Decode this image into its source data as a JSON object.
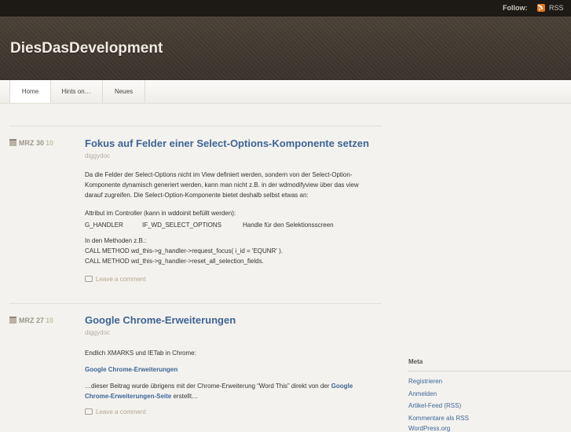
{
  "topbar": {
    "follow": "Follow:",
    "rss": "RSS"
  },
  "site": {
    "title": "DiesDasDevelopment"
  },
  "nav": {
    "items": [
      "Home",
      "Hints on…",
      "Neues"
    ]
  },
  "posts": [
    {
      "date": "MRZ 30",
      "year": "10",
      "title": "Fokus auf Felder einer Select-Options-Komponente setzen",
      "author": "diggydoc",
      "p1": [
        "Da die Felder der Select-Options nicht im View definiert werden, sondern von der Select-Option-",
        "Komponente dynamisch generiert werden, kann man nicht z.B. in der wdmodifyview über das view",
        "darauf zugreifen. Die Select-Option-Komponente bietet deshalb selbst etwas an:"
      ],
      "p2_line1": "Attribut im Controller (kann in wddoinit befüllt werden):",
      "p2_col1": "G_HANDLER",
      "p2_col2": "IF_WD_SELECT_OPTIONS",
      "p2_col3": "Handle für den Selektionsscreen",
      "p3": [
        "In den Methoden z.B.:",
        "CALL METHOD wd_this->g_handler->request_focus( i_id = 'EQUNR' ).",
        "CALL METHOD wd_this->g_handler->reset_all_selection_fields."
      ],
      "comment": "Leave a comment"
    },
    {
      "date": "MRZ 27",
      "year": "10",
      "title": "Google Chrome-Erweiterungen",
      "author": "diggydoc",
      "p1": "Endlich XMARKS und IETab in Chrome:",
      "link": "Google Chrome-Erweiterungen",
      "p3_a": "…dieser Beitrag wurde übrigens mit der Chrome-Erweiterung “Word This” direkt von der",
      "p3_link1": "Google",
      "p3_link2": "Chrome-Erweiterungen-Seite",
      "p3_b": "erstellt…",
      "comment": "Leave a comment"
    }
  ],
  "sidebar": {
    "title": "Meta",
    "links": [
      "Registrieren",
      "Anmelden",
      "Artikel-Feed (RSS)",
      "Kommentare als RSS",
      "WordPress.org"
    ]
  }
}
